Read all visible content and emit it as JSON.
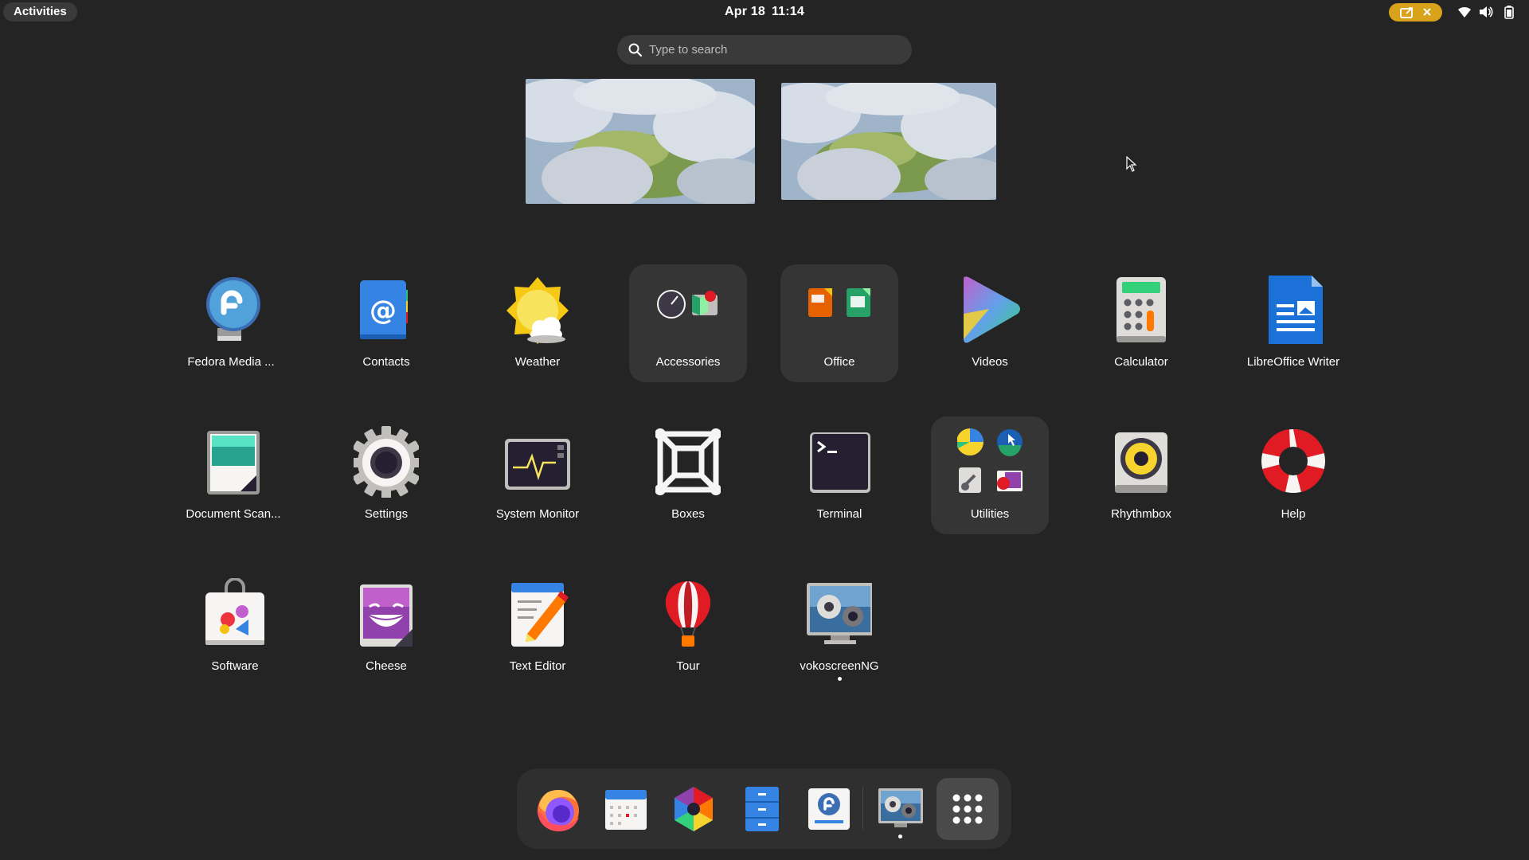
{
  "topbar": {
    "activities_label": "Activities",
    "date": "Apr 18",
    "time": "11:14",
    "screencast_color": "#d9a21b",
    "tray_icons": [
      "wifi-icon",
      "volume-icon",
      "battery-icon"
    ]
  },
  "search": {
    "placeholder": "Type to search",
    "value": ""
  },
  "workspaces": [
    "workspace-1",
    "workspace-2"
  ],
  "apps": [
    {
      "label": "Fedora Media ...",
      "icon": "fedora-media-writer-icon"
    },
    {
      "label": "Contacts",
      "icon": "contacts-icon"
    },
    {
      "label": "Weather",
      "icon": "weather-icon"
    },
    {
      "label": "Accessories",
      "icon": "accessories-folder-icon",
      "folder": true
    },
    {
      "label": "Office",
      "icon": "office-folder-icon",
      "folder": true
    },
    {
      "label": "Videos",
      "icon": "videos-icon"
    },
    {
      "label": "Calculator",
      "icon": "calculator-icon"
    },
    {
      "label": "LibreOffice Writer",
      "icon": "libreoffice-writer-icon"
    },
    {
      "label": "Document Scan...",
      "icon": "document-scanner-icon"
    },
    {
      "label": "Settings",
      "icon": "settings-gear-icon"
    },
    {
      "label": "System Monitor",
      "icon": "system-monitor-icon"
    },
    {
      "label": "Boxes",
      "icon": "boxes-icon"
    },
    {
      "label": "Terminal",
      "icon": "terminal-icon"
    },
    {
      "label": "Utilities",
      "icon": "utilities-folder-icon",
      "folder": true
    },
    {
      "label": "Rhythmbox",
      "icon": "rhythmbox-icon"
    },
    {
      "label": "Help",
      "icon": "help-lifebuoy-icon"
    },
    {
      "label": "Software",
      "icon": "software-icon"
    },
    {
      "label": "Cheese",
      "icon": "cheese-icon"
    },
    {
      "label": "Text Editor",
      "icon": "text-editor-icon"
    },
    {
      "label": "Tour",
      "icon": "tour-balloon-icon"
    },
    {
      "label": "vokoscreenNG",
      "icon": "vokoscreenng-icon",
      "running": true
    }
  ],
  "dash": [
    {
      "name": "firefox",
      "icon": "firefox-icon"
    },
    {
      "name": "calendar",
      "icon": "calendar-icon"
    },
    {
      "name": "photos",
      "icon": "photos-icon"
    },
    {
      "name": "files",
      "icon": "files-icon"
    },
    {
      "name": "fedora-media-writer",
      "icon": "fedora-media-writer-icon"
    },
    {
      "name": "vokoscreenNG",
      "icon": "vokoscreenng-icon",
      "running": true
    },
    {
      "name": "show-apps",
      "icon": "app-grid-icon"
    }
  ]
}
